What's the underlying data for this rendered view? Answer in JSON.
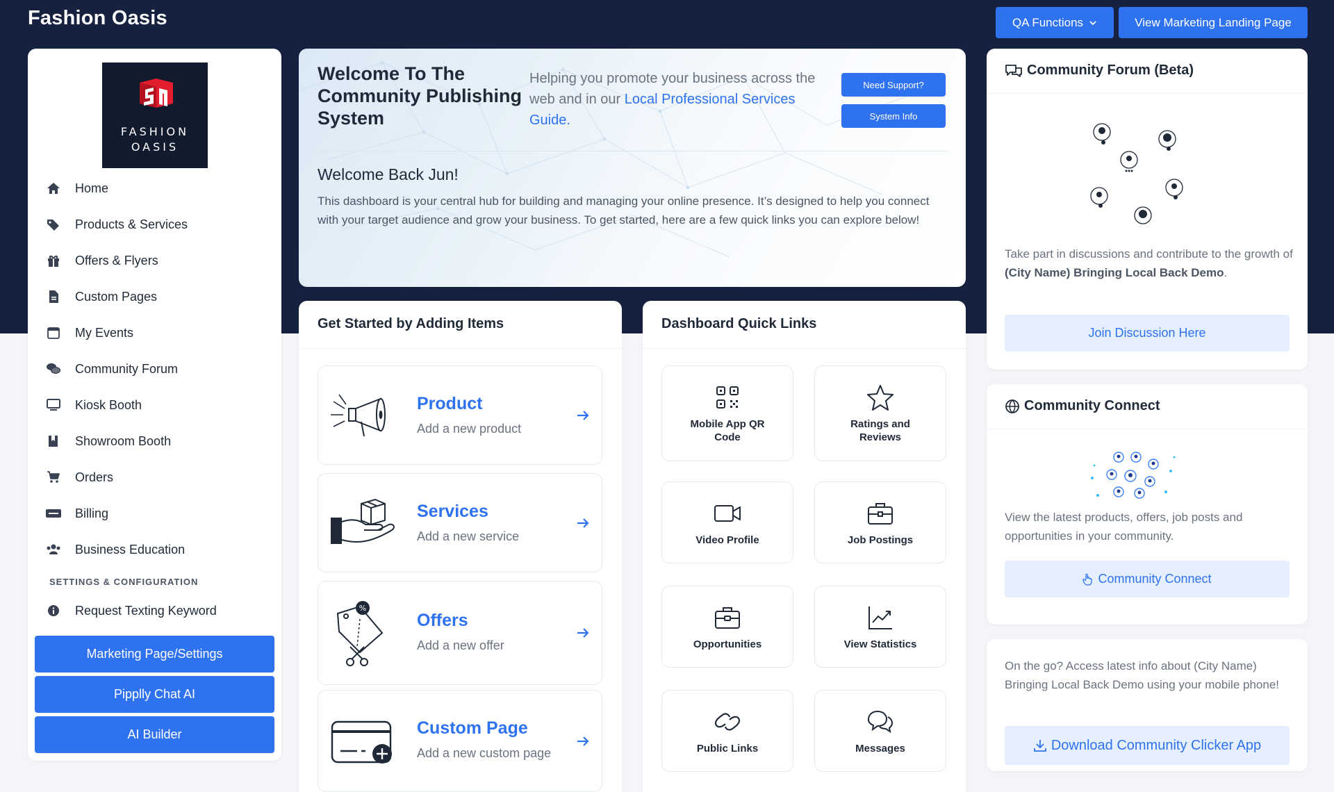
{
  "header": {
    "brand": "Fashion Oasis",
    "qa_button": "QA Functions",
    "landing_button": "View Marketing Landing Page"
  },
  "sidebar": {
    "logo_line1": "FASHION",
    "logo_line2": "OASIS",
    "items": [
      {
        "label": "Home",
        "icon": "home-icon"
      },
      {
        "label": "Products & Services",
        "icon": "tags-icon"
      },
      {
        "label": "Offers & Flyers",
        "icon": "gift-icon"
      },
      {
        "label": "Custom Pages",
        "icon": "file-icon"
      },
      {
        "label": "My Events",
        "icon": "calendar-icon"
      },
      {
        "label": "Community Forum",
        "icon": "comments-icon"
      },
      {
        "label": "Kiosk Booth",
        "icon": "monitor-icon"
      },
      {
        "label": "Showroom Booth",
        "icon": "book-icon"
      },
      {
        "label": "Orders",
        "icon": "cart-icon"
      },
      {
        "label": "Billing",
        "icon": "stripe-icon"
      },
      {
        "label": "Business Education",
        "icon": "users-icon"
      }
    ],
    "section_label": "SETTINGS & CONFIGURATION",
    "settings_item": "Request Texting Keyword",
    "buttons": [
      "Marketing Page/Settings",
      "Pipplly Chat AI",
      "AI Builder"
    ]
  },
  "welcome": {
    "title": "Welcome To The Community Publishing System",
    "subtitle_prefix": "Helping you promote your business across the web and in our ",
    "subtitle_link": "Local Professional Services Guide",
    "subtitle_suffix": ".",
    "support_button": "Need Support?",
    "sysinfo_button": "System Info",
    "greeting": "Welcome Back Jun!",
    "body": "This dashboard is your central hub for building and managing your online presence. It’s designed to help you connect with your target audience and grow your business. To get started, here are a few quick links you can explore below!"
  },
  "add_items": {
    "title": "Get Started by Adding Items",
    "tiles": [
      {
        "name": "Product",
        "desc": "Add a new product"
      },
      {
        "name": "Services",
        "desc": "Add a new service"
      },
      {
        "name": "Offers",
        "desc": "Add a new offer"
      },
      {
        "name": "Custom Page",
        "desc": "Add a new custom page"
      }
    ]
  },
  "quick_links": {
    "title": "Dashboard Quick Links",
    "tiles": [
      {
        "label": "Mobile App QR Code",
        "icon": "qr-code-icon"
      },
      {
        "label": "Ratings and Reviews",
        "icon": "star-icon"
      },
      {
        "label": "Video Profile",
        "icon": "video-icon"
      },
      {
        "label": "Job Postings",
        "icon": "briefcase-icon"
      },
      {
        "label": "Opportunities",
        "icon": "toolbox-icon"
      },
      {
        "label": "View Statistics",
        "icon": "chart-line-icon"
      },
      {
        "label": "Public Links",
        "icon": "link-icon"
      },
      {
        "label": "Messages",
        "icon": "messages-icon"
      }
    ]
  },
  "forum": {
    "title": "Community Forum (Beta)",
    "text_prefix": "Take part in discussions and contribute to the growth of ",
    "text_bold": "(City Name) Bringing Local Back Demo",
    "text_suffix": ".",
    "button": "Join Discussion Here"
  },
  "connect": {
    "title": "Community Connect",
    "text": "View the latest products, offers, job posts and opportunities in your community.",
    "button": "Community Connect"
  },
  "clicker": {
    "text": "On the go? Access latest info about (City Name) Bringing Local Back Demo using your mobile phone!",
    "button": "Download Community Clicker App"
  },
  "colors": {
    "navy": "#15213f",
    "accent": "#2f72f0",
    "light_accent": "#e6efff"
  }
}
